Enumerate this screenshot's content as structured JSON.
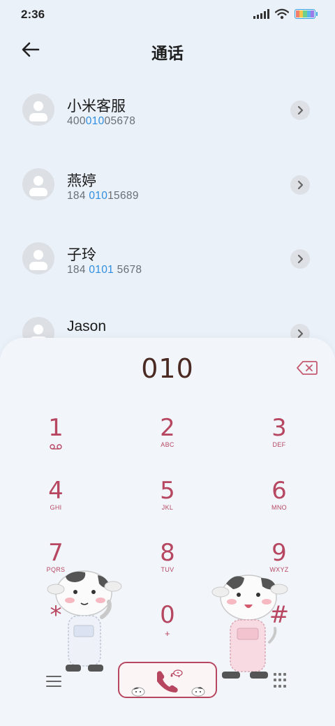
{
  "status": {
    "time": "2:36"
  },
  "header": {
    "title": "通话"
  },
  "contacts": [
    {
      "name": "小米客服",
      "number_pre": "400",
      "number_hl": "010",
      "number_post": "05678"
    },
    {
      "name": "燕婷",
      "number_pre": "184 ",
      "number_hl": "010",
      "number_post": "15689"
    },
    {
      "name": "子玲",
      "number_pre": "184 ",
      "number_hl": "0101",
      "number_post": " 5678"
    },
    {
      "name": "Jason",
      "number_pre": "",
      "number_hl": "",
      "number_post": ""
    }
  ],
  "dialer": {
    "number": "010"
  },
  "keys": [
    {
      "digit": "1",
      "letters": ""
    },
    {
      "digit": "2",
      "letters": "ABC"
    },
    {
      "digit": "3",
      "letters": "DEF"
    },
    {
      "digit": "4",
      "letters": "GHI"
    },
    {
      "digit": "5",
      "letters": "JKL"
    },
    {
      "digit": "6",
      "letters": "MNO"
    },
    {
      "digit": "7",
      "letters": "PQRS"
    },
    {
      "digit": "8",
      "letters": "TUV"
    },
    {
      "digit": "9",
      "letters": "WXYZ"
    },
    {
      "digit": "*",
      "letters": ""
    },
    {
      "digit": "0",
      "letters": "+"
    },
    {
      "digit": "#",
      "letters": ""
    }
  ],
  "colors": {
    "accent": "#b74761",
    "highlight": "#2f8ee0",
    "background": "#eaf1f9"
  },
  "icons": [
    "back-arrow-icon",
    "chevron-right-icon",
    "avatar-icon",
    "delete-icon",
    "voicemail-icon",
    "phone-icon",
    "menu-icon",
    "keypad-grid-icon"
  ]
}
